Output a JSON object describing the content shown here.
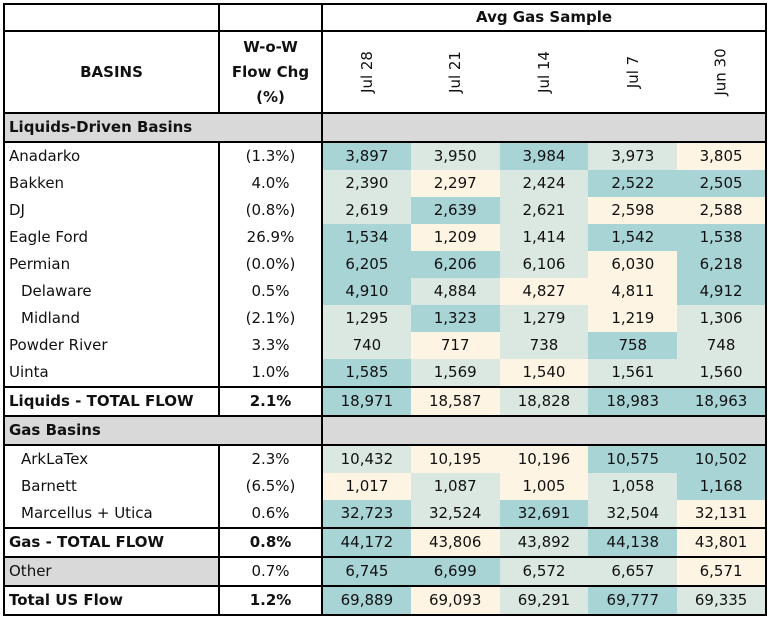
{
  "header": {
    "group_title": "Avg Gas Sample",
    "basins_label": "BASINS",
    "chg_label_1": "W-o-W",
    "chg_label_2": "Flow Chg",
    "chg_label_3": "(%)",
    "dates": [
      "Jul 28",
      "Jul 21",
      "Jul 14",
      "Jul 7",
      "Jun 30"
    ]
  },
  "colors": {
    "low": "#fdf4e3",
    "mid": "#dbe8e2",
    "high": "#a9d4d6",
    "section": "#d9d9d9"
  },
  "liquids": {
    "title": "Liquids-Driven Basins",
    "rows": [
      {
        "name": "Anadarko",
        "chg": "(1.3%)",
        "vals": [
          "3,897",
          "3,950",
          "3,984",
          "3,973",
          "3,805"
        ],
        "shade": [
          "high",
          "mid",
          "high",
          "mid",
          "low"
        ],
        "indent": false
      },
      {
        "name": "Bakken",
        "chg": "4.0%",
        "vals": [
          "2,390",
          "2,297",
          "2,424",
          "2,522",
          "2,505"
        ],
        "shade": [
          "mid",
          "low",
          "mid",
          "high",
          "high"
        ],
        "indent": false
      },
      {
        "name": "DJ",
        "chg": "(0.8%)",
        "vals": [
          "2,619",
          "2,639",
          "2,621",
          "2,598",
          "2,588"
        ],
        "shade": [
          "mid",
          "high",
          "mid",
          "low",
          "low"
        ],
        "indent": false
      },
      {
        "name": "Eagle Ford",
        "chg": "26.9%",
        "vals": [
          "1,534",
          "1,209",
          "1,414",
          "1,542",
          "1,538"
        ],
        "shade": [
          "high",
          "low",
          "mid",
          "high",
          "high"
        ],
        "indent": false
      },
      {
        "name": "Permian",
        "chg": "(0.0%)",
        "vals": [
          "6,205",
          "6,206",
          "6,106",
          "6,030",
          "6,218"
        ],
        "shade": [
          "high",
          "high",
          "mid",
          "low",
          "high"
        ],
        "indent": false
      },
      {
        "name": "Delaware",
        "chg": "0.5%",
        "vals": [
          "4,910",
          "4,884",
          "4,827",
          "4,811",
          "4,912"
        ],
        "shade": [
          "high",
          "mid",
          "low",
          "low",
          "high"
        ],
        "indent": true
      },
      {
        "name": "Midland",
        "chg": "(2.1%)",
        "vals": [
          "1,295",
          "1,323",
          "1,279",
          "1,219",
          "1,306"
        ],
        "shade": [
          "mid",
          "high",
          "mid",
          "low",
          "mid"
        ],
        "indent": true
      },
      {
        "name": "Powder River",
        "chg": "3.3%",
        "vals": [
          "740",
          "717",
          "738",
          "758",
          "748"
        ],
        "shade": [
          "mid",
          "low",
          "mid",
          "high",
          "mid"
        ],
        "indent": false
      },
      {
        "name": "Uinta",
        "chg": "1.0%",
        "vals": [
          "1,585",
          "1,569",
          "1,540",
          "1,561",
          "1,560"
        ],
        "shade": [
          "high",
          "mid",
          "low",
          "mid",
          "mid"
        ],
        "indent": false
      }
    ],
    "total": {
      "name": "Liquids - TOTAL FLOW",
      "chg": "2.1%",
      "vals": [
        "18,971",
        "18,587",
        "18,828",
        "18,983",
        "18,963"
      ],
      "shade": [
        "high",
        "low",
        "mid",
        "high",
        "high"
      ]
    }
  },
  "gas": {
    "title": "Gas Basins",
    "rows": [
      {
        "name": "ArkLaTex",
        "chg": "2.3%",
        "vals": [
          "10,432",
          "10,195",
          "10,196",
          "10,575",
          "10,502"
        ],
        "shade": [
          "mid",
          "low",
          "low",
          "high",
          "high"
        ],
        "indent": true
      },
      {
        "name": "Barnett",
        "chg": "(6.5%)",
        "vals": [
          "1,017",
          "1,087",
          "1,005",
          "1,058",
          "1,168"
        ],
        "shade": [
          "low",
          "mid",
          "low",
          "mid",
          "high"
        ],
        "indent": true
      },
      {
        "name": "Marcellus + Utica",
        "chg": "0.6%",
        "vals": [
          "32,723",
          "32,524",
          "32,691",
          "32,504",
          "32,131"
        ],
        "shade": [
          "high",
          "mid",
          "high",
          "mid",
          "low"
        ],
        "indent": true
      }
    ],
    "total": {
      "name": "Gas - TOTAL FLOW",
      "chg": "0.8%",
      "vals": [
        "44,172",
        "43,806",
        "43,892",
        "44,138",
        "43,801"
      ],
      "shade": [
        "high",
        "low",
        "mid",
        "high",
        "low"
      ]
    }
  },
  "other": {
    "name": "Other",
    "chg": "0.7%",
    "vals": [
      "6,745",
      "6,699",
      "6,572",
      "6,657",
      "6,571"
    ],
    "shade": [
      "high",
      "high",
      "mid",
      "mid",
      "low"
    ]
  },
  "us_total": {
    "name": "Total US Flow",
    "chg": "1.2%",
    "vals": [
      "69,889",
      "69,093",
      "69,291",
      "69,777",
      "69,335"
    ],
    "shade": [
      "high",
      "low",
      "mid",
      "high",
      "mid"
    ]
  }
}
